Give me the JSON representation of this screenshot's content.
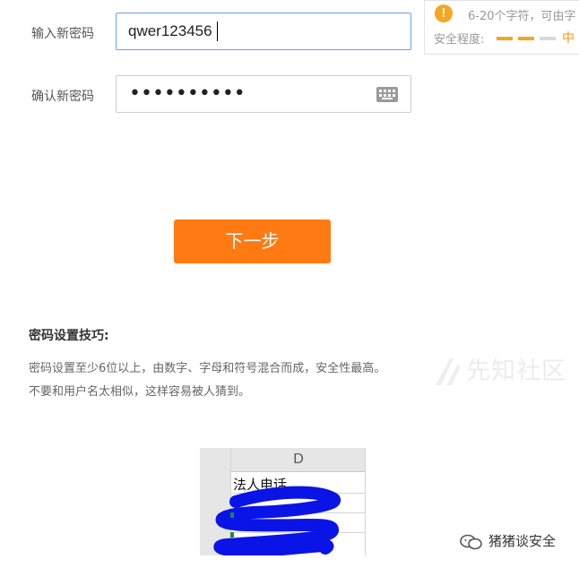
{
  "form": {
    "new_password_label": "输入新密码",
    "new_password_value": "qwer123456",
    "confirm_password_label": "确认新密码",
    "confirm_password_value": "••••••••••"
  },
  "tooltip": {
    "hint": "6-20个字符，可由字",
    "strength_label": "安全程度:",
    "strength_value": "中",
    "strength_level": 0.66,
    "colors": {
      "active": "#f5a623",
      "inactive": "#d9d9d9"
    }
  },
  "actions": {
    "next_label": "下一步"
  },
  "tips": {
    "title": "密码设置技巧:",
    "line1": "密码设置至少6位以上，由数字、字母和符号混合而成，安全性最高。",
    "line2": "不要和用户名太相似，这样容易被人猜到。"
  },
  "watermark": {
    "text": "先知社区"
  },
  "spreadsheet": {
    "column_header": "D",
    "cell_text": "法人电话"
  },
  "footer": {
    "account": "猪猪谈安全"
  },
  "colors": {
    "primary_button": "#ff7a12",
    "focus_border": "#6aa0e8",
    "redaction": "#0a14e6"
  }
}
